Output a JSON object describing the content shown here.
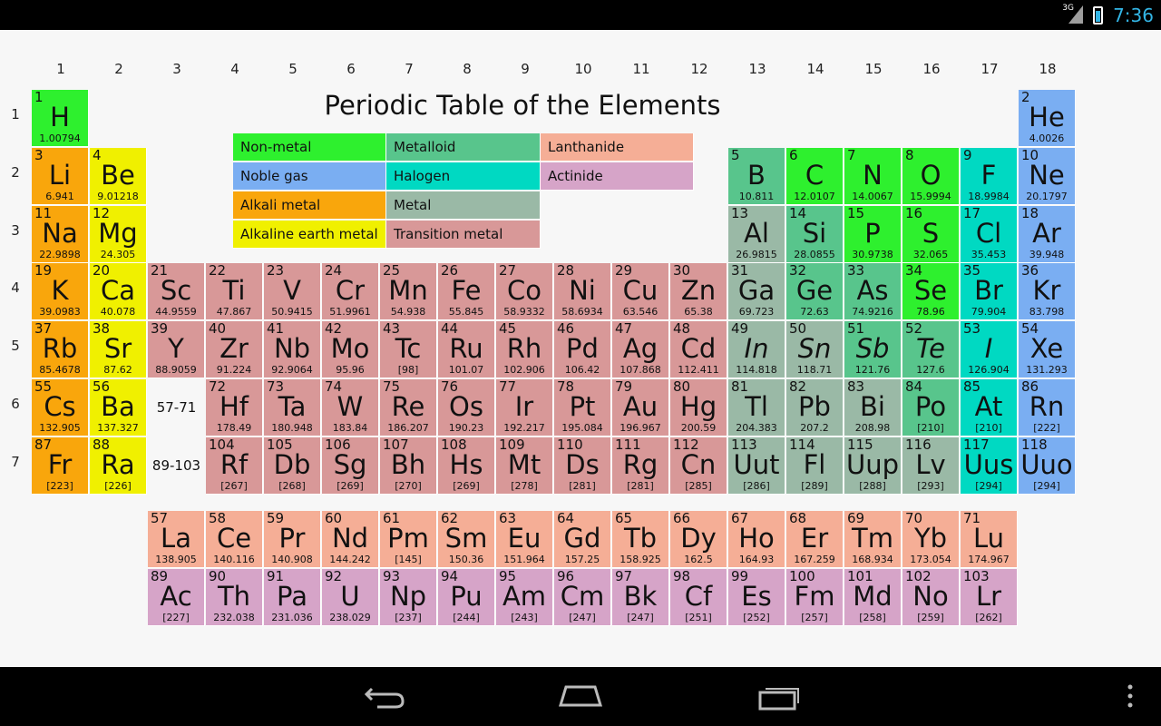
{
  "status_bar": {
    "time": "7:36",
    "network": "3G"
  },
  "title": "Periodic Table of the Elements",
  "groups": [
    "1",
    "2",
    "3",
    "4",
    "5",
    "6",
    "7",
    "8",
    "9",
    "10",
    "11",
    "12",
    "13",
    "14",
    "15",
    "16",
    "17",
    "18"
  ],
  "periods": [
    "1",
    "2",
    "3",
    "4",
    "5",
    "6",
    "7"
  ],
  "series_ranges": {
    "lanthanides": "57-71",
    "actinides": "89-103"
  },
  "legend": [
    {
      "label": "Non-metal",
      "color": "#2ef02e"
    },
    {
      "label": "Metalloid",
      "color": "#58c58c"
    },
    {
      "label": "Lanthanide",
      "color": "#f5ae96"
    },
    {
      "label": "Noble gas",
      "color": "#7aaef2"
    },
    {
      "label": "Halogen",
      "color": "#00d9c2"
    },
    {
      "label": "Actinide",
      "color": "#d6a4c8"
    },
    {
      "label": "Alkali metal",
      "color": "#f9a60c"
    },
    {
      "label": "Metal",
      "color": "#9ab9a6"
    },
    {
      "label": "Alkaline earth metal",
      "color": "#f0f000"
    },
    {
      "label": "Transition metal",
      "color": "#d89898"
    }
  ],
  "category_colors": {
    "nonmetal": "#2ef02e",
    "metalloid": "#58c58c",
    "lanthanide": "#f5ae96",
    "noble": "#7aaef2",
    "halogen": "#00d9c2",
    "actinide": "#d6a4c8",
    "alkali": "#f9a60c",
    "metal": "#9ab9a6",
    "alkaline": "#f0f000",
    "transition": "#d89898"
  },
  "elements": [
    {
      "z": "1",
      "s": "H",
      "m": "1.00794",
      "g": 1,
      "p": 1,
      "c": "nonmetal"
    },
    {
      "z": "2",
      "s": "He",
      "m": "4.0026",
      "g": 18,
      "p": 1,
      "c": "noble"
    },
    {
      "z": "3",
      "s": "Li",
      "m": "6.941",
      "g": 1,
      "p": 2,
      "c": "alkali"
    },
    {
      "z": "4",
      "s": "Be",
      "m": "9.01218",
      "g": 2,
      "p": 2,
      "c": "alkaline"
    },
    {
      "z": "5",
      "s": "B",
      "m": "10.811",
      "g": 13,
      "p": 2,
      "c": "metalloid"
    },
    {
      "z": "6",
      "s": "C",
      "m": "12.0107",
      "g": 14,
      "p": 2,
      "c": "nonmetal"
    },
    {
      "z": "7",
      "s": "N",
      "m": "14.0067",
      "g": 15,
      "p": 2,
      "c": "nonmetal"
    },
    {
      "z": "8",
      "s": "O",
      "m": "15.9994",
      "g": 16,
      "p": 2,
      "c": "nonmetal"
    },
    {
      "z": "9",
      "s": "F",
      "m": "18.9984",
      "g": 17,
      "p": 2,
      "c": "halogen"
    },
    {
      "z": "10",
      "s": "Ne",
      "m": "20.1797",
      "g": 18,
      "p": 2,
      "c": "noble"
    },
    {
      "z": "11",
      "s": "Na",
      "m": "22.9898",
      "g": 1,
      "p": 3,
      "c": "alkali"
    },
    {
      "z": "12",
      "s": "Mg",
      "m": "24.305",
      "g": 2,
      "p": 3,
      "c": "alkaline"
    },
    {
      "z": "13",
      "s": "Al",
      "m": "26.9815",
      "g": 13,
      "p": 3,
      "c": "metal"
    },
    {
      "z": "14",
      "s": "Si",
      "m": "28.0855",
      "g": 14,
      "p": 3,
      "c": "metalloid"
    },
    {
      "z": "15",
      "s": "P",
      "m": "30.9738",
      "g": 15,
      "p": 3,
      "c": "nonmetal"
    },
    {
      "z": "16",
      "s": "S",
      "m": "32.065",
      "g": 16,
      "p": 3,
      "c": "nonmetal"
    },
    {
      "z": "17",
      "s": "Cl",
      "m": "35.453",
      "g": 17,
      "p": 3,
      "c": "halogen"
    },
    {
      "z": "18",
      "s": "Ar",
      "m": "39.948",
      "g": 18,
      "p": 3,
      "c": "noble"
    },
    {
      "z": "19",
      "s": "K",
      "m": "39.0983",
      "g": 1,
      "p": 4,
      "c": "alkali"
    },
    {
      "z": "20",
      "s": "Ca",
      "m": "40.078",
      "g": 2,
      "p": 4,
      "c": "alkaline"
    },
    {
      "z": "21",
      "s": "Sc",
      "m": "44.9559",
      "g": 3,
      "p": 4,
      "c": "transition"
    },
    {
      "z": "22",
      "s": "Ti",
      "m": "47.867",
      "g": 4,
      "p": 4,
      "c": "transition"
    },
    {
      "z": "23",
      "s": "V",
      "m": "50.9415",
      "g": 5,
      "p": 4,
      "c": "transition"
    },
    {
      "z": "24",
      "s": "Cr",
      "m": "51.9961",
      "g": 6,
      "p": 4,
      "c": "transition"
    },
    {
      "z": "25",
      "s": "Mn",
      "m": "54.938",
      "g": 7,
      "p": 4,
      "c": "transition"
    },
    {
      "z": "26",
      "s": "Fe",
      "m": "55.845",
      "g": 8,
      "p": 4,
      "c": "transition"
    },
    {
      "z": "27",
      "s": "Co",
      "m": "58.9332",
      "g": 9,
      "p": 4,
      "c": "transition"
    },
    {
      "z": "28",
      "s": "Ni",
      "m": "58.6934",
      "g": 10,
      "p": 4,
      "c": "transition"
    },
    {
      "z": "29",
      "s": "Cu",
      "m": "63.546",
      "g": 11,
      "p": 4,
      "c": "transition"
    },
    {
      "z": "30",
      "s": "Zn",
      "m": "65.38",
      "g": 12,
      "p": 4,
      "c": "transition"
    },
    {
      "z": "31",
      "s": "Ga",
      "m": "69.723",
      "g": 13,
      "p": 4,
      "c": "metal"
    },
    {
      "z": "32",
      "s": "Ge",
      "m": "72.63",
      "g": 14,
      "p": 4,
      "c": "metalloid"
    },
    {
      "z": "33",
      "s": "As",
      "m": "74.9216",
      "g": 15,
      "p": 4,
      "c": "metalloid"
    },
    {
      "z": "34",
      "s": "Se",
      "m": "78.96",
      "g": 16,
      "p": 4,
      "c": "nonmetal"
    },
    {
      "z": "35",
      "s": "Br",
      "m": "79.904",
      "g": 17,
      "p": 4,
      "c": "halogen"
    },
    {
      "z": "36",
      "s": "Kr",
      "m": "83.798",
      "g": 18,
      "p": 4,
      "c": "noble"
    },
    {
      "z": "37",
      "s": "Rb",
      "m": "85.4678",
      "g": 1,
      "p": 5,
      "c": "alkali"
    },
    {
      "z": "38",
      "s": "Sr",
      "m": "87.62",
      "g": 2,
      "p": 5,
      "c": "alkaline"
    },
    {
      "z": "39",
      "s": "Y",
      "m": "88.9059",
      "g": 3,
      "p": 5,
      "c": "transition"
    },
    {
      "z": "40",
      "s": "Zr",
      "m": "91.224",
      "g": 4,
      "p": 5,
      "c": "transition"
    },
    {
      "z": "41",
      "s": "Nb",
      "m": "92.9064",
      "g": 5,
      "p": 5,
      "c": "transition"
    },
    {
      "z": "42",
      "s": "Mo",
      "m": "95.96",
      "g": 6,
      "p": 5,
      "c": "transition"
    },
    {
      "z": "43",
      "s": "Tc",
      "m": "[98]",
      "g": 7,
      "p": 5,
      "c": "transition"
    },
    {
      "z": "44",
      "s": "Ru",
      "m": "101.07",
      "g": 8,
      "p": 5,
      "c": "transition"
    },
    {
      "z": "45",
      "s": "Rh",
      "m": "102.906",
      "g": 9,
      "p": 5,
      "c": "transition"
    },
    {
      "z": "46",
      "s": "Pd",
      "m": "106.42",
      "g": 10,
      "p": 5,
      "c": "transition"
    },
    {
      "z": "47",
      "s": "Ag",
      "m": "107.868",
      "g": 11,
      "p": 5,
      "c": "transition"
    },
    {
      "z": "48",
      "s": "Cd",
      "m": "112.411",
      "g": 12,
      "p": 5,
      "c": "transition"
    },
    {
      "z": "49",
      "s": "In",
      "m": "114.818",
      "g": 13,
      "p": 5,
      "c": "metal",
      "it": true
    },
    {
      "z": "50",
      "s": "Sn",
      "m": "118.71",
      "g": 14,
      "p": 5,
      "c": "metal",
      "it": true
    },
    {
      "z": "51",
      "s": "Sb",
      "m": "121.76",
      "g": 15,
      "p": 5,
      "c": "metalloid",
      "it": true
    },
    {
      "z": "52",
      "s": "Te",
      "m": "127.6",
      "g": 16,
      "p": 5,
      "c": "metalloid",
      "it": true
    },
    {
      "z": "53",
      "s": "I",
      "m": "126.904",
      "g": 17,
      "p": 5,
      "c": "halogen",
      "it": true
    },
    {
      "z": "54",
      "s": "Xe",
      "m": "131.293",
      "g": 18,
      "p": 5,
      "c": "noble"
    },
    {
      "z": "55",
      "s": "Cs",
      "m": "132.905",
      "g": 1,
      "p": 6,
      "c": "alkali"
    },
    {
      "z": "56",
      "s": "Ba",
      "m": "137.327",
      "g": 2,
      "p": 6,
      "c": "alkaline"
    },
    {
      "z": "72",
      "s": "Hf",
      "m": "178.49",
      "g": 4,
      "p": 6,
      "c": "transition"
    },
    {
      "z": "73",
      "s": "Ta",
      "m": "180.948",
      "g": 5,
      "p": 6,
      "c": "transition"
    },
    {
      "z": "74",
      "s": "W",
      "m": "183.84",
      "g": 6,
      "p": 6,
      "c": "transition"
    },
    {
      "z": "75",
      "s": "Re",
      "m": "186.207",
      "g": 7,
      "p": 6,
      "c": "transition"
    },
    {
      "z": "76",
      "s": "Os",
      "m": "190.23",
      "g": 8,
      "p": 6,
      "c": "transition"
    },
    {
      "z": "77",
      "s": "Ir",
      "m": "192.217",
      "g": 9,
      "p": 6,
      "c": "transition"
    },
    {
      "z": "78",
      "s": "Pt",
      "m": "195.084",
      "g": 10,
      "p": 6,
      "c": "transition"
    },
    {
      "z": "79",
      "s": "Au",
      "m": "196.967",
      "g": 11,
      "p": 6,
      "c": "transition"
    },
    {
      "z": "80",
      "s": "Hg",
      "m": "200.59",
      "g": 12,
      "p": 6,
      "c": "transition"
    },
    {
      "z": "81",
      "s": "Tl",
      "m": "204.383",
      "g": 13,
      "p": 6,
      "c": "metal"
    },
    {
      "z": "82",
      "s": "Pb",
      "m": "207.2",
      "g": 14,
      "p": 6,
      "c": "metal"
    },
    {
      "z": "83",
      "s": "Bi",
      "m": "208.98",
      "g": 15,
      "p": 6,
      "c": "metal"
    },
    {
      "z": "84",
      "s": "Po",
      "m": "[210]",
      "g": 16,
      "p": 6,
      "c": "metalloid"
    },
    {
      "z": "85",
      "s": "At",
      "m": "[210]",
      "g": 17,
      "p": 6,
      "c": "halogen"
    },
    {
      "z": "86",
      "s": "Rn",
      "m": "[222]",
      "g": 18,
      "p": 6,
      "c": "noble"
    },
    {
      "z": "87",
      "s": "Fr",
      "m": "[223]",
      "g": 1,
      "p": 7,
      "c": "alkali"
    },
    {
      "z": "88",
      "s": "Ra",
      "m": "[226]",
      "g": 2,
      "p": 7,
      "c": "alkaline"
    },
    {
      "z": "104",
      "s": "Rf",
      "m": "[267]",
      "g": 4,
      "p": 7,
      "c": "transition"
    },
    {
      "z": "105",
      "s": "Db",
      "m": "[268]",
      "g": 5,
      "p": 7,
      "c": "transition"
    },
    {
      "z": "106",
      "s": "Sg",
      "m": "[269]",
      "g": 6,
      "p": 7,
      "c": "transition"
    },
    {
      "z": "107",
      "s": "Bh",
      "m": "[270]",
      "g": 7,
      "p": 7,
      "c": "transition"
    },
    {
      "z": "108",
      "s": "Hs",
      "m": "[269]",
      "g": 8,
      "p": 7,
      "c": "transition"
    },
    {
      "z": "109",
      "s": "Mt",
      "m": "[278]",
      "g": 9,
      "p": 7,
      "c": "transition"
    },
    {
      "z": "110",
      "s": "Ds",
      "m": "[281]",
      "g": 10,
      "p": 7,
      "c": "transition"
    },
    {
      "z": "111",
      "s": "Rg",
      "m": "[281]",
      "g": 11,
      "p": 7,
      "c": "transition"
    },
    {
      "z": "112",
      "s": "Cn",
      "m": "[285]",
      "g": 12,
      "p": 7,
      "c": "transition"
    },
    {
      "z": "113",
      "s": "Uut",
      "m": "[286]",
      "g": 13,
      "p": 7,
      "c": "metal"
    },
    {
      "z": "114",
      "s": "Fl",
      "m": "[289]",
      "g": 14,
      "p": 7,
      "c": "metal"
    },
    {
      "z": "115",
      "s": "Uup",
      "m": "[288]",
      "g": 15,
      "p": 7,
      "c": "metal"
    },
    {
      "z": "116",
      "s": "Lv",
      "m": "[293]",
      "g": 16,
      "p": 7,
      "c": "metal"
    },
    {
      "z": "117",
      "s": "Uus",
      "m": "[294]",
      "g": 17,
      "p": 7,
      "c": "halogen"
    },
    {
      "z": "118",
      "s": "Uuo",
      "m": "[294]",
      "g": 18,
      "p": 7,
      "c": "noble"
    },
    {
      "z": "57",
      "s": "La",
      "m": "138.905",
      "g": 3,
      "p": 8,
      "c": "lanthanide"
    },
    {
      "z": "58",
      "s": "Ce",
      "m": "140.116",
      "g": 4,
      "p": 8,
      "c": "lanthanide"
    },
    {
      "z": "59",
      "s": "Pr",
      "m": "140.908",
      "g": 5,
      "p": 8,
      "c": "lanthanide"
    },
    {
      "z": "60",
      "s": "Nd",
      "m": "144.242",
      "g": 6,
      "p": 8,
      "c": "lanthanide"
    },
    {
      "z": "61",
      "s": "Pm",
      "m": "[145]",
      "g": 7,
      "p": 8,
      "c": "lanthanide"
    },
    {
      "z": "62",
      "s": "Sm",
      "m": "150.36",
      "g": 8,
      "p": 8,
      "c": "lanthanide"
    },
    {
      "z": "63",
      "s": "Eu",
      "m": "151.964",
      "g": 9,
      "p": 8,
      "c": "lanthanide"
    },
    {
      "z": "64",
      "s": "Gd",
      "m": "157.25",
      "g": 10,
      "p": 8,
      "c": "lanthanide"
    },
    {
      "z": "65",
      "s": "Tb",
      "m": "158.925",
      "g": 11,
      "p": 8,
      "c": "lanthanide"
    },
    {
      "z": "66",
      "s": "Dy",
      "m": "162.5",
      "g": 12,
      "p": 8,
      "c": "lanthanide"
    },
    {
      "z": "67",
      "s": "Ho",
      "m": "164.93",
      "g": 13,
      "p": 8,
      "c": "lanthanide"
    },
    {
      "z": "68",
      "s": "Er",
      "m": "167.259",
      "g": 14,
      "p": 8,
      "c": "lanthanide"
    },
    {
      "z": "69",
      "s": "Tm",
      "m": "168.934",
      "g": 15,
      "p": 8,
      "c": "lanthanide"
    },
    {
      "z": "70",
      "s": "Yb",
      "m": "173.054",
      "g": 16,
      "p": 8,
      "c": "lanthanide"
    },
    {
      "z": "71",
      "s": "Lu",
      "m": "174.967",
      "g": 17,
      "p": 8,
      "c": "lanthanide"
    },
    {
      "z": "89",
      "s": "Ac",
      "m": "[227]",
      "g": 3,
      "p": 9,
      "c": "actinide"
    },
    {
      "z": "90",
      "s": "Th",
      "m": "232.038",
      "g": 4,
      "p": 9,
      "c": "actinide"
    },
    {
      "z": "91",
      "s": "Pa",
      "m": "231.036",
      "g": 5,
      "p": 9,
      "c": "actinide"
    },
    {
      "z": "92",
      "s": "U",
      "m": "238.029",
      "g": 6,
      "p": 9,
      "c": "actinide"
    },
    {
      "z": "93",
      "s": "Np",
      "m": "[237]",
      "g": 7,
      "p": 9,
      "c": "actinide"
    },
    {
      "z": "94",
      "s": "Pu",
      "m": "[244]",
      "g": 8,
      "p": 9,
      "c": "actinide"
    },
    {
      "z": "95",
      "s": "Am",
      "m": "[243]",
      "g": 9,
      "p": 9,
      "c": "actinide"
    },
    {
      "z": "96",
      "s": "Cm",
      "m": "[247]",
      "g": 10,
      "p": 9,
      "c": "actinide"
    },
    {
      "z": "97",
      "s": "Bk",
      "m": "[247]",
      "g": 11,
      "p": 9,
      "c": "actinide"
    },
    {
      "z": "98",
      "s": "Cf",
      "m": "[251]",
      "g": 12,
      "p": 9,
      "c": "actinide"
    },
    {
      "z": "99",
      "s": "Es",
      "m": "[252]",
      "g": 13,
      "p": 9,
      "c": "actinide"
    },
    {
      "z": "100",
      "s": "Fm",
      "m": "[257]",
      "g": 14,
      "p": 9,
      "c": "actinide"
    },
    {
      "z": "101",
      "s": "Md",
      "m": "[258]",
      "g": 15,
      "p": 9,
      "c": "actinide"
    },
    {
      "z": "102",
      "s": "No",
      "m": "[259]",
      "g": 16,
      "p": 9,
      "c": "actinide"
    },
    {
      "z": "103",
      "s": "Lr",
      "m": "[262]",
      "g": 17,
      "p": 9,
      "c": "actinide"
    }
  ],
  "nav_bar": {
    "icons": [
      "back-icon",
      "home-icon",
      "recent-apps-icon",
      "overflow-menu-icon"
    ]
  }
}
